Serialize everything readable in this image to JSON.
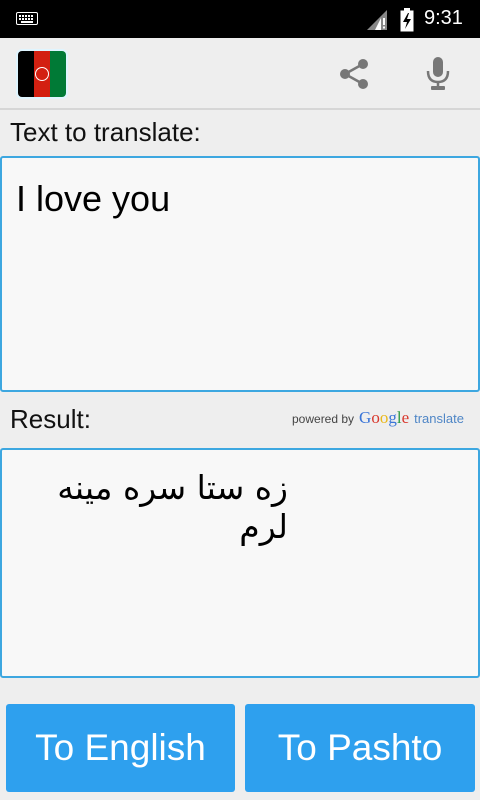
{
  "status_bar": {
    "time": "9:31",
    "icons": [
      "keyboard-icon",
      "signal-icon",
      "battery-charging-icon"
    ]
  },
  "action_bar": {
    "flag": "afghanistan-flag",
    "share_icon": "share-icon",
    "mic_icon": "microphone-icon"
  },
  "input": {
    "label": "Text to translate:",
    "value": "I love you"
  },
  "result": {
    "label": "Result:",
    "value": "زه ستا سره مینه لرم"
  },
  "attribution": {
    "powered_by": "powered by",
    "google": "Google",
    "translate": "translate"
  },
  "buttons": {
    "to_english": "To English",
    "to_pashto": "To Pashto"
  },
  "colors": {
    "accent": "#2ea0ee",
    "border": "#3da7e0",
    "background": "#eeeeee"
  }
}
